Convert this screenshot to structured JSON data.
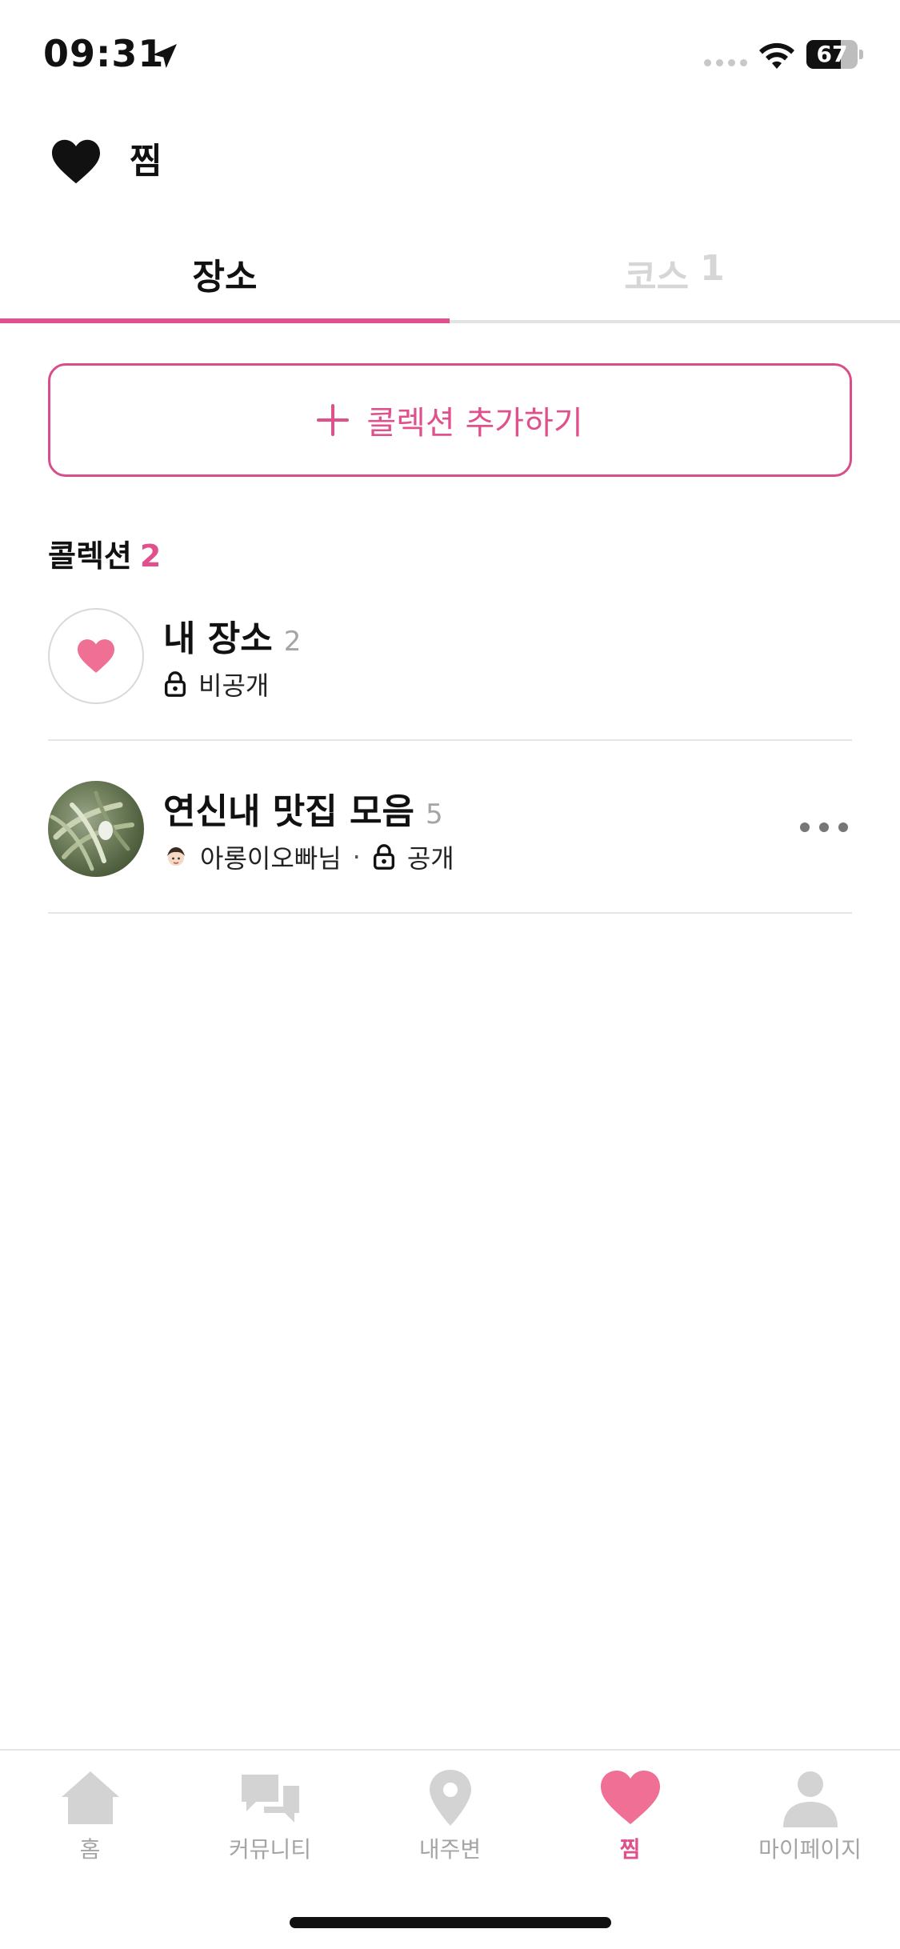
{
  "status_bar": {
    "time": "09:31",
    "battery_percent": 67,
    "battery_label": "67"
  },
  "header": {
    "title": "찜"
  },
  "tabs": [
    {
      "label": "장소",
      "active": true
    },
    {
      "label": "코스",
      "count": "1",
      "active": false
    }
  ],
  "add_collection": {
    "label": "콜렉션 추가하기"
  },
  "collections_section": {
    "title": "콜렉션",
    "count": "2"
  },
  "collections": [
    {
      "name": "내 장소",
      "count": "2",
      "visibility": "비공개",
      "thumbnail": "heart-icon"
    },
    {
      "name": "연신내 맛집 모음",
      "count": "5",
      "owner": "아롱이오빠님",
      "separator": "·",
      "visibility": "공개",
      "thumbnail": "food-photo"
    }
  ],
  "bottom_nav": [
    {
      "label": "홈",
      "icon": "home-icon",
      "active": false
    },
    {
      "label": "커뮤니티",
      "icon": "chat-icon",
      "active": false
    },
    {
      "label": "내주변",
      "icon": "location-pin-icon",
      "active": false
    },
    {
      "label": "찜",
      "icon": "heart-icon",
      "active": true
    },
    {
      "label": "마이페이지",
      "icon": "person-icon",
      "active": false
    }
  ],
  "colors": {
    "accent": "#e0508c",
    "heart_pink": "#f06f95",
    "inactive": "#a5a5a5",
    "nav_icon_inactive": "#d3d3d3"
  }
}
